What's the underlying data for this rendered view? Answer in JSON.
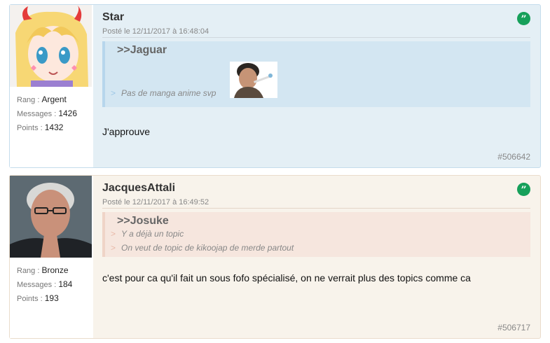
{
  "posts": [
    {
      "username": "Star",
      "date": "Posté le 12/11/2017 à 16:48:04",
      "stats": {
        "rank_label": "Rang :",
        "rank_value": "Argent",
        "messages_label": "Messages :",
        "messages_value": "1426",
        "points_label": "Points :",
        "points_value": "1432"
      },
      "quote": {
        "author": ">>Jaguar",
        "lines": [
          ">",
          "Pas de manga anime svp"
        ]
      },
      "message": "J'approuve",
      "id": "#506642"
    },
    {
      "username": "JacquesAttali",
      "date": "Posté le 12/11/2017 à 16:49:52",
      "stats": {
        "rank_label": "Rang :",
        "rank_value": "Bronze",
        "messages_label": "Messages :",
        "messages_value": "184",
        "points_label": "Points :",
        "points_value": "193"
      },
      "quote": {
        "author": ">>Josuke",
        "lines": [
          "Y a déjà un topic",
          "On veut de topic de kikoojap de merde partout"
        ]
      },
      "message": "c'est pour ca qu'il fait un sous fofo spécialisé, on ne verrait plus des topics comme ca",
      "id": "#506717"
    }
  ],
  "quote_icon": "”",
  "quote_marker": ">",
  "colors": {
    "quote_button": "#16a05a",
    "post1_bg": "#e4eff5",
    "post2_bg": "#f8f3eb"
  }
}
